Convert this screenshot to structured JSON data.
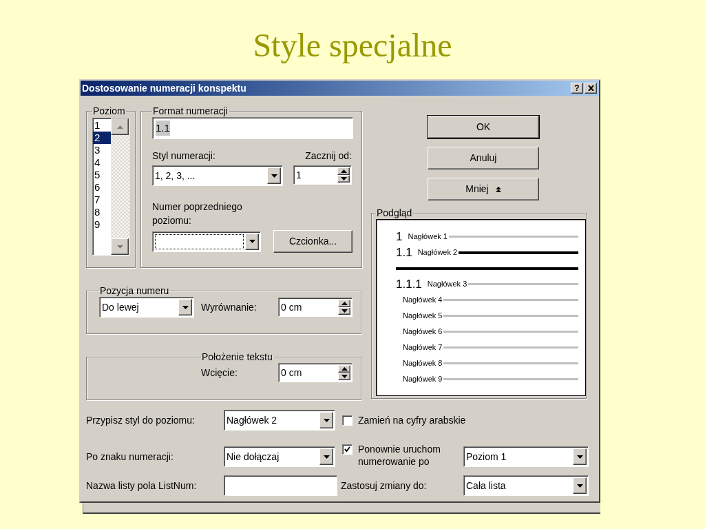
{
  "slide_title": "Style specjalne",
  "dialog": {
    "title": "Dostosowanie numeracji konspektu",
    "help_button": "?"
  },
  "level_group": {
    "label": "Poziom",
    "items": [
      {
        "label": "1",
        "selected": false
      },
      {
        "label": "2",
        "selected": true
      },
      {
        "label": "3",
        "selected": false
      },
      {
        "label": "4",
        "selected": false
      },
      {
        "label": "5",
        "selected": false
      },
      {
        "label": "6",
        "selected": false
      },
      {
        "label": "7",
        "selected": false
      },
      {
        "label": "8",
        "selected": false
      },
      {
        "label": "9",
        "selected": false
      }
    ]
  },
  "format_group": {
    "label": "Format numeracji",
    "format_value": "1.1",
    "style_label": "Styl numeracji:",
    "style_value": "1, 2, 3, ...",
    "start_label": "Zacznij od:",
    "start_value": "1",
    "prev_level_label": "Numer poprzedniego poziomu:",
    "font_button": "Czcionka..."
  },
  "buttons": [
    {
      "label": "OK",
      "kind": "default"
    },
    {
      "label": "Anuluj",
      "kind": "plain"
    },
    {
      "label": "Mniej",
      "kind": "collapse"
    }
  ],
  "number_position": {
    "label": "Pozycja numeru",
    "align_value": "Do lewej",
    "offset_label": "Wyrównanie:",
    "offset_value": "0 cm"
  },
  "text_position": {
    "label": "Położenie tekstu",
    "indent_label": "Wcięcie:",
    "indent_value": "0 cm"
  },
  "preview": {
    "label": "Podgląd",
    "rows": [
      {
        "kind": "level",
        "number": "1",
        "label": "Nagłówek 1"
      },
      {
        "kind": "current",
        "number": "1.1",
        "label": "Nagłówek 2"
      },
      {
        "kind": "text"
      },
      {
        "kind": "level",
        "number": "1.1.1",
        "label": "Nagłówek 3"
      },
      {
        "kind": "level",
        "label": "Nagłówek 4"
      },
      {
        "kind": "level",
        "label": "Nagłówek 5"
      },
      {
        "kind": "level",
        "label": "Nagłówek 6"
      },
      {
        "kind": "level",
        "label": "Nagłówek 7"
      },
      {
        "kind": "level",
        "label": "Nagłówek 8"
      },
      {
        "kind": "level",
        "label": "Nagłówek 9"
      }
    ]
  },
  "assign_style": {
    "label": "Przypisz styl do poziomu:",
    "value": "Nagłówek 2"
  },
  "arabic": {
    "label": "Zamień na cyfry arabskie",
    "checked": false
  },
  "follow_number": {
    "label": "Po znaku numeracji:",
    "value": "Nie dołączaj"
  },
  "restart": {
    "label": "Ponownie uruchom numerowanie po",
    "checked": true,
    "value": "Poziom 1"
  },
  "listnum": {
    "label": "Nazwa listy pola ListNum:"
  },
  "apply": {
    "label": "Zastosuj zmiany do:",
    "value": "Cała lista"
  }
}
